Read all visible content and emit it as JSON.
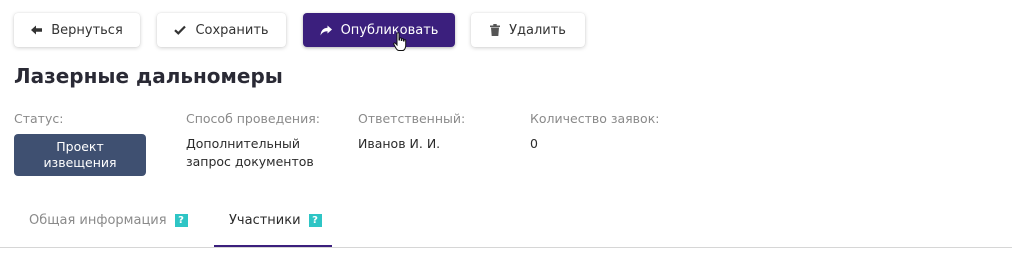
{
  "toolbar": {
    "back_label": "Вернуться",
    "save_label": "Сохранить",
    "publish_label": "Опубликовать",
    "delete_label": "Удалить",
    "accent_color": "#3b1f7d"
  },
  "page": {
    "title": "Лазерные дальномеры"
  },
  "fields": {
    "status": {
      "label": "Статус:",
      "value": "Проект извещения",
      "badge_color": "#3f5071"
    },
    "method": {
      "label": "Способ проведения:",
      "value_line1": "Дополнительный",
      "value_line2": "запрос документов"
    },
    "responsible": {
      "label": "Ответственный:",
      "value": "Иванов И. И."
    },
    "applications": {
      "label": "Количество заявок:",
      "value": "0"
    }
  },
  "tabs": [
    {
      "label": "Общая информация",
      "help": "?",
      "active": false
    },
    {
      "label": "Участники",
      "help": "?",
      "active": true
    }
  ],
  "icons": {
    "back": "arrow-left-icon",
    "save": "check-icon",
    "publish": "share-arrow-icon",
    "delete": "trash-icon",
    "cursor": "hand-pointer-icon"
  }
}
